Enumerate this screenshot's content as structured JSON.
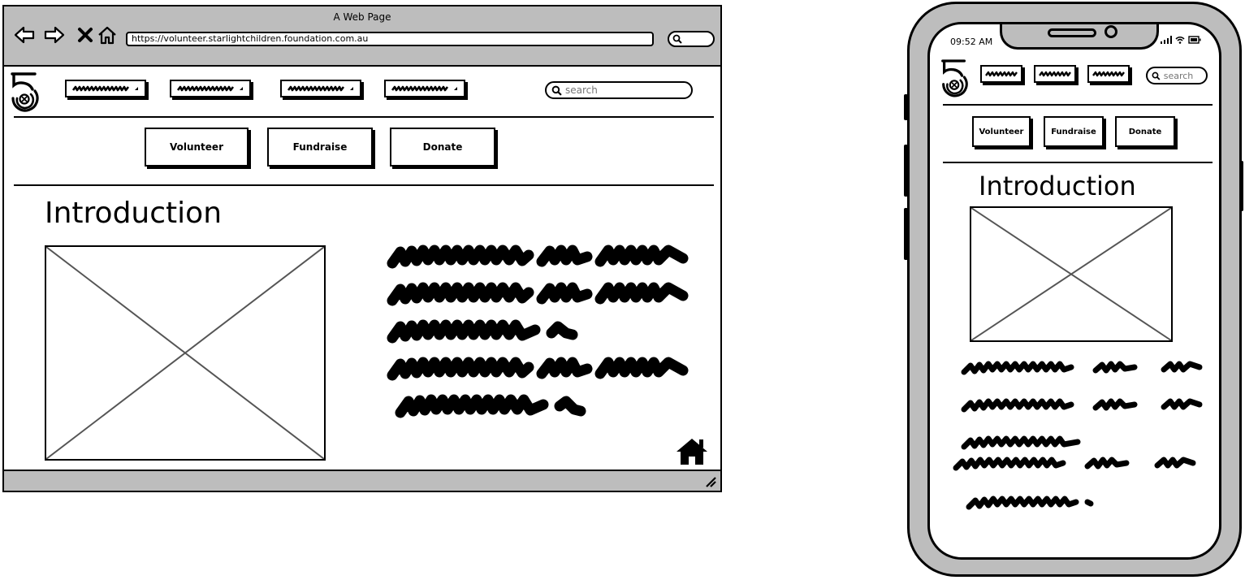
{
  "desktop": {
    "window_title": "A Web Page",
    "url": "https://volunteer.starlightchildren.foundation.com.au",
    "nav_icons": [
      "back-arrow-icon",
      "forward-arrow-icon",
      "close-x-icon",
      "home-outline-icon"
    ],
    "search_placeholder": "search",
    "buttons": {
      "volunteer": "Volunteer",
      "fundraise": "Fundraise",
      "donate": "Donate"
    },
    "heading": "Introduction"
  },
  "mobile": {
    "time": "09:52 AM",
    "search_placeholder": "search",
    "buttons": {
      "volunteer": "Volunteer",
      "fundraise": "Fundraise",
      "donate": "Donate"
    },
    "heading": "Introduction"
  },
  "colors": {
    "chrome_gray": "#bdbdbd",
    "ink": "#000000",
    "placeholder_line": "#555555"
  }
}
